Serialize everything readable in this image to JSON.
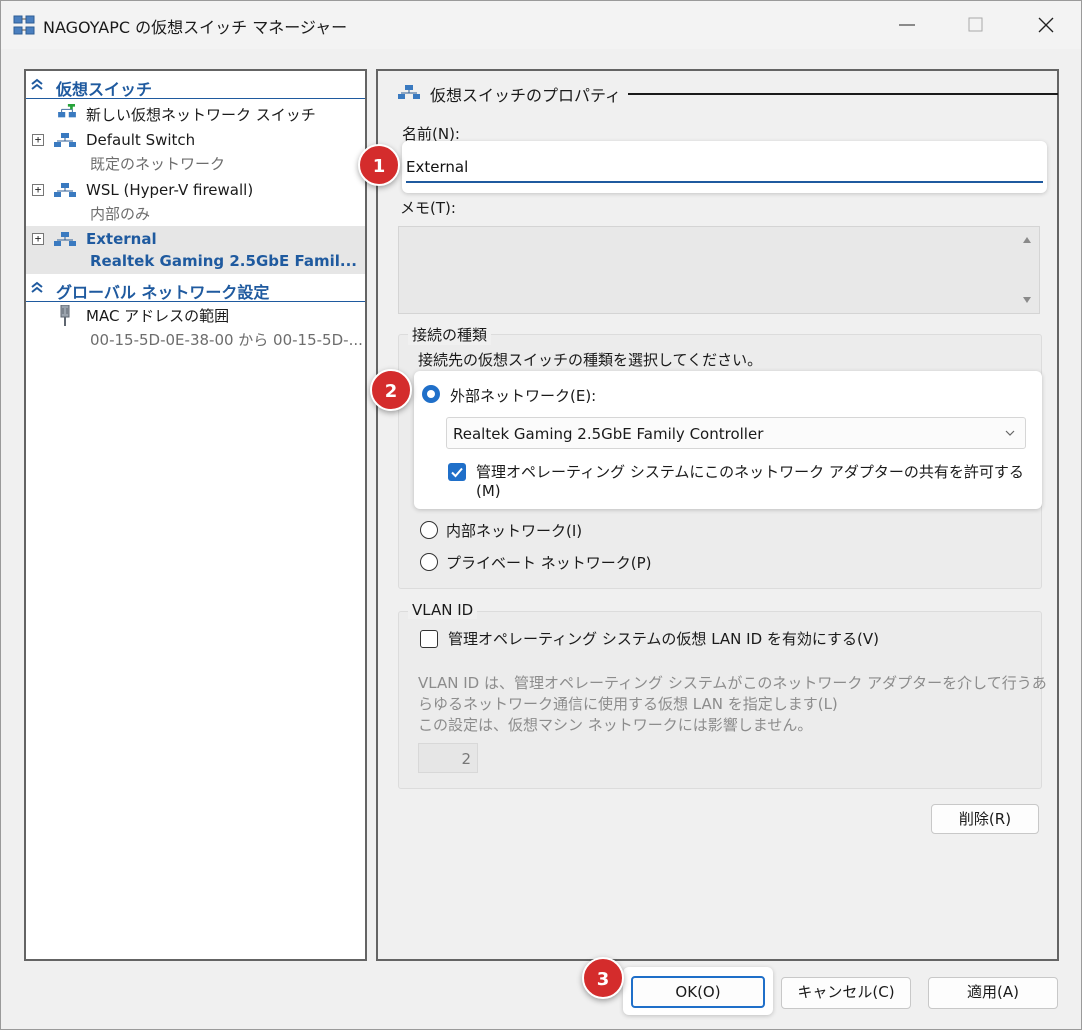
{
  "window": {
    "title": "NAGOYAPC の仮想スイッチ マネージャー"
  },
  "sidebar": {
    "section_virtual_switches": "仮想スイッチ",
    "new_switch": "新しい仮想ネットワーク スイッチ",
    "items": [
      {
        "title": "Default Switch",
        "subtitle": "既定のネットワーク"
      },
      {
        "title": "WSL (Hyper-V firewall)",
        "subtitle": "内部のみ"
      },
      {
        "title": "External",
        "subtitle": "Realtek Gaming 2.5GbE Famil..."
      }
    ],
    "section_global": "グローバル ネットワーク設定",
    "mac_title": "MAC アドレスの範囲",
    "mac_subtitle": "00-15-5D-0E-38-00 から 00-15-5D-..."
  },
  "props": {
    "header": "仮想スイッチのプロパティ",
    "name_label": "名前(N):",
    "name_value": "External",
    "memo_label": "メモ(T):",
    "conn_group": "接続の種類",
    "conn_prompt": "接続先の仮想スイッチの種類を選択してください。",
    "external_label": "外部ネットワーク(E):",
    "adapter_value": "Realtek Gaming 2.5GbE Family Controller",
    "share_label_1": "管理オペレーティング システムにこのネットワーク アダプターの共有を許可する",
    "share_label_2": "(M)",
    "internal_label": "内部ネットワーク(I)",
    "private_label": "プライベート ネットワーク(P)",
    "vlan_group": "VLAN ID",
    "vlan_check_label": "管理オペレーティング システムの仮想 LAN ID を有効にする(V)",
    "vlan_desc_1": "VLAN ID は、管理オペレーティング システムがこのネットワーク アダプターを介して行うあ",
    "vlan_desc_2": "らゆるネットワーク通信に使用する仮想 LAN を指定します(L)",
    "vlan_desc_3": "この設定は、仮想マシン ネットワークには影響しません。",
    "vlan_value": "2",
    "delete_button": "削除(R)"
  },
  "footer": {
    "ok": "OK(O)",
    "cancel": "キャンセル(C)",
    "apply": "適用(A)"
  },
  "badges": [
    "1",
    "2",
    "3"
  ],
  "colors": {
    "accent": "#1f6fc9",
    "section_blue": "#1f5a9f",
    "badge_red": "#d42c2c"
  }
}
